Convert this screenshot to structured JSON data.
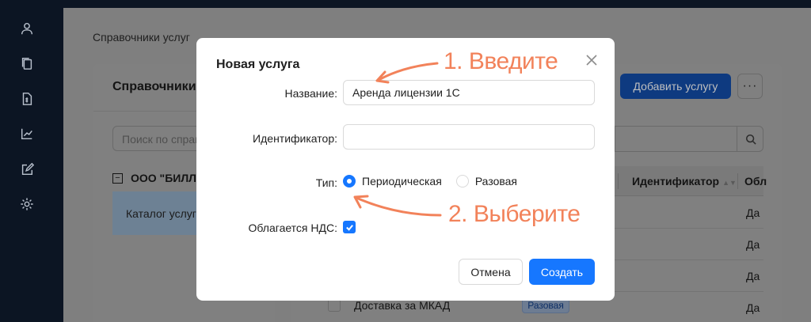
{
  "sidebar": {
    "icons": [
      "user-icon",
      "documents-icon",
      "invoice-icon",
      "chart-icon",
      "edit-icon",
      "gear-icon"
    ]
  },
  "page": {
    "breadcrumb": "Справочники услуг"
  },
  "left_panel": {
    "title": "Справочники",
    "search_placeholder": "Поиск по справ",
    "tree_root": "ООО \"БИЛЛ",
    "tree_toggle": "−",
    "selected_item": "Каталог услуг"
  },
  "right_panel": {
    "add_button": "Добавить услугу",
    "more_button": "···",
    "columns": [
      "Идентификатор",
      "Обл"
    ],
    "rows_vat": [
      "Да",
      "Да",
      "Да",
      "Да"
    ],
    "bottom_row": {
      "name": "Доставка за МКАД",
      "type": "Разовая"
    }
  },
  "modal": {
    "title": "Новая услуга",
    "fields": {
      "name_label": "Название",
      "name_value": "Аренда лицензии 1С",
      "id_label": "Идентификатор",
      "id_value": "",
      "type_label": "Тип",
      "type_options": [
        "Периодическая",
        "Разовая"
      ],
      "type_selected": "Периодическая",
      "vat_label": "Облагается НДС",
      "vat_checked": true
    },
    "cancel_button": "Отмена",
    "create_button": "Создать"
  },
  "annotations": {
    "step1": "1. Введите",
    "step2": "2. Выберите",
    "color": "#f2825a"
  },
  "colors": {
    "primary": "#1677ff",
    "sidebar": "#0c1523"
  }
}
